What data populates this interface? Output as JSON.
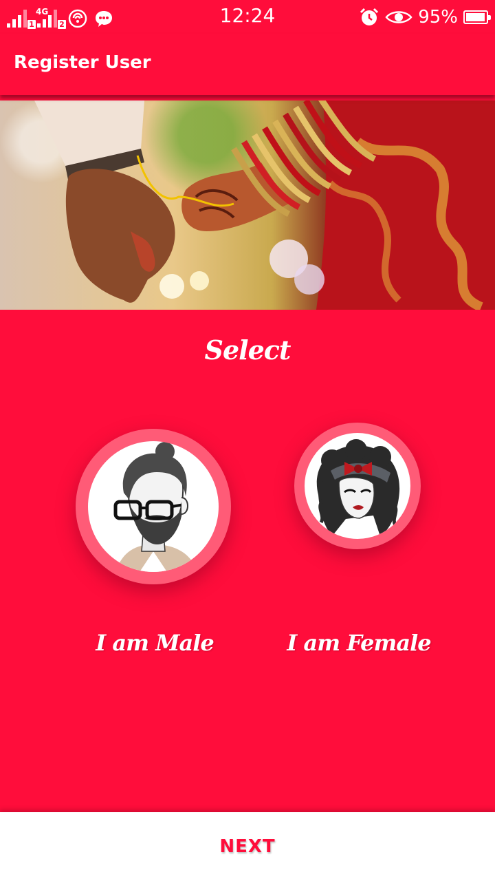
{
  "status_bar": {
    "sim1": {
      "network": "",
      "slot": "1"
    },
    "sim2": {
      "network": "4G",
      "slot": "2"
    },
    "icons": [
      "hotspot-icon",
      "message-icon",
      "alarm-icon",
      "eye-icon",
      "battery-icon"
    ],
    "time": "12:24",
    "battery_percent": "95%",
    "battery_level": 0.95
  },
  "app_bar": {
    "title": "Register User"
  },
  "banner": {
    "image": "wedding-hands-photo"
  },
  "main": {
    "title": "Select",
    "options": [
      {
        "id": "male",
        "label": "I am Male",
        "avatar": "male-sketch-avatar"
      },
      {
        "id": "female",
        "label": "I am Female",
        "avatar": "female-sketch-avatar"
      }
    ]
  },
  "footer": {
    "next_label": "NEXT"
  },
  "colors": {
    "primary": "#ff0d3b",
    "avatar_ring": "#ff5b77",
    "surface": "#ffffff"
  }
}
